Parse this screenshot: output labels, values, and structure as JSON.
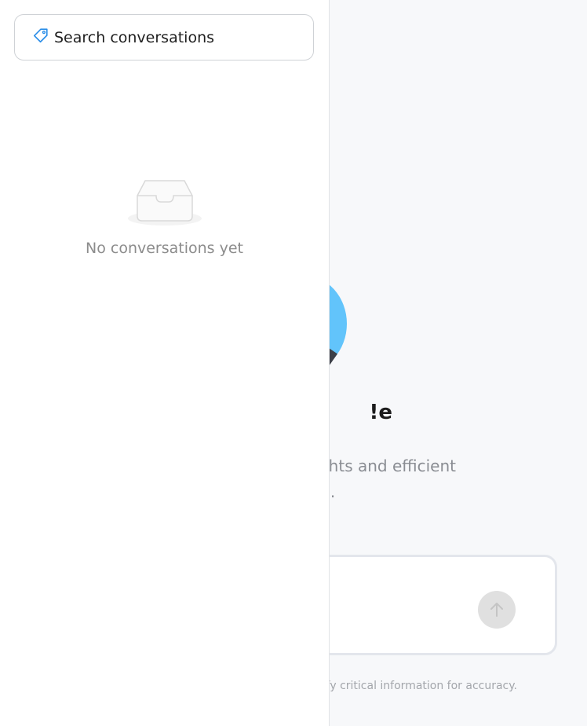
{
  "sidebar": {
    "search": {
      "placeholder": "Search conversations"
    },
    "empty_state": {
      "text": "No conversations yet"
    }
  },
  "main": {
    "welcome_title": "e!",
    "welcome_subtitle_lines": [
      "sights and efficient",
      "ing."
    ],
    "disclaimer": "erify critical information for accuracy."
  },
  "colors": {
    "accent": "#62c4fb",
    "search_icon": "#2b8ee8",
    "send_button": "#e0e0e0"
  },
  "icons": {
    "search": "tag-icon",
    "empty": "inbox-icon",
    "send": "arrow-up-icon"
  }
}
